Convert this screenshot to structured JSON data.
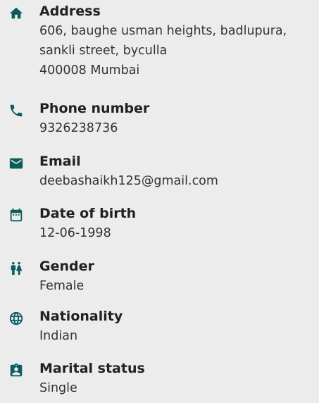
{
  "colors": {
    "background": "#ececec",
    "icon": "#0d5c5c",
    "label": "#212121",
    "value": "#333333"
  },
  "details": [
    {
      "icon": "home-icon",
      "label": "Address",
      "lines": [
        "606, baughe usman heights, badlupura,",
        "sankli street, byculla",
        "400008 Mumbai"
      ]
    },
    {
      "icon": "phone-icon",
      "label": "Phone number",
      "lines": [
        "9326238736"
      ]
    },
    {
      "icon": "mail-icon",
      "label": "Email",
      "lines": [
        "deebashaikh125@gmail.com"
      ]
    },
    {
      "icon": "calendar-icon",
      "label": "Date of birth",
      "lines": [
        "12-06-1998"
      ]
    },
    {
      "icon": "gender-icon",
      "label": "Gender",
      "lines": [
        "Female"
      ]
    },
    {
      "icon": "globe-icon",
      "label": "Nationality",
      "lines": [
        "Indian"
      ]
    },
    {
      "icon": "id-badge-icon",
      "label": "Marital status",
      "lines": [
        "Single"
      ]
    }
  ]
}
